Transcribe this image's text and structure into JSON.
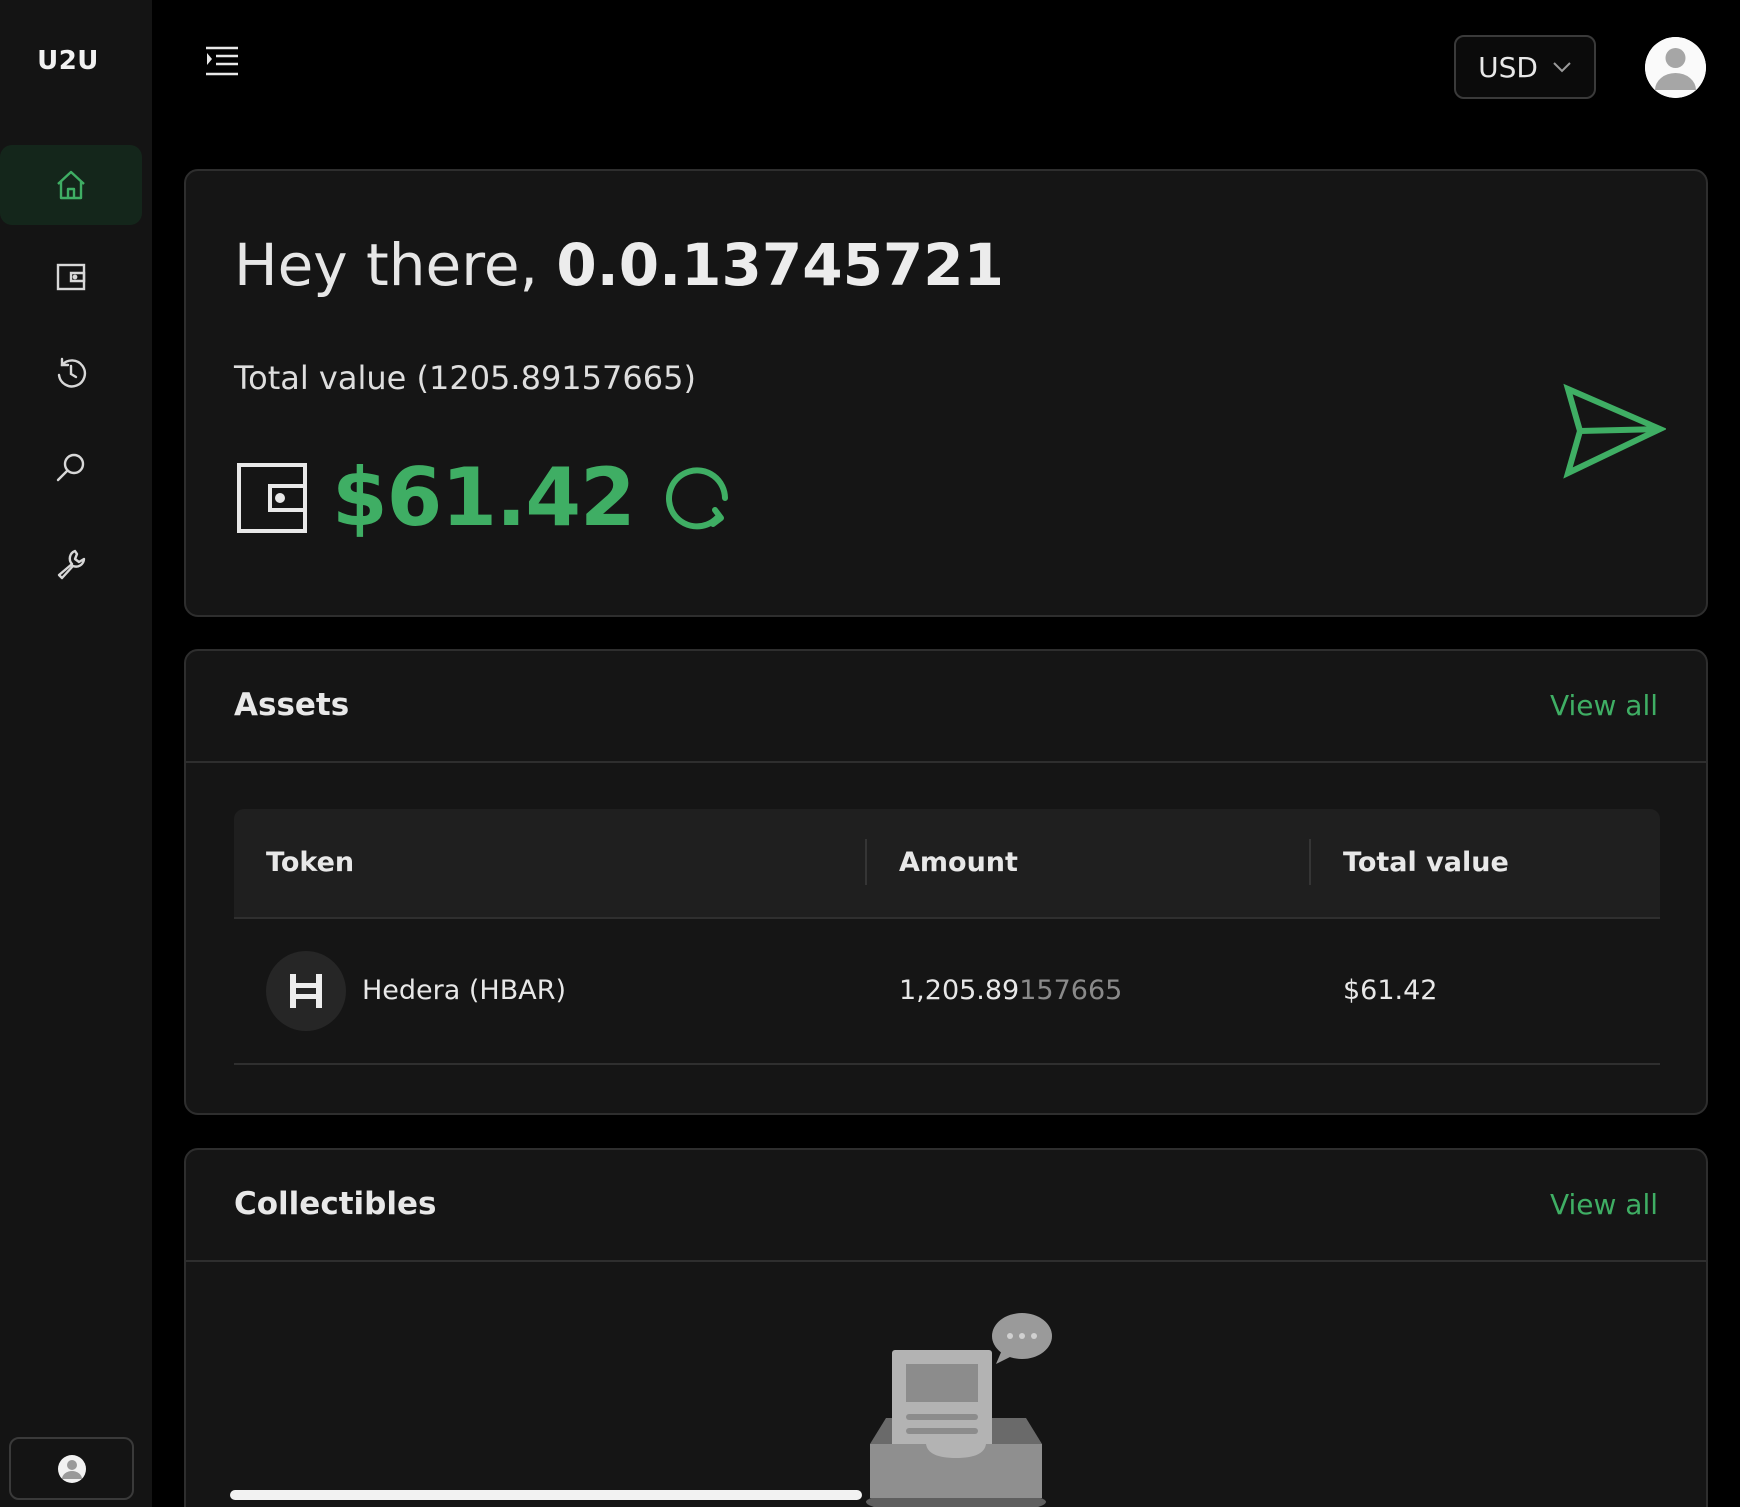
{
  "app": {
    "logo": "U2U"
  },
  "sidebar": {
    "items": [
      {
        "icon": "home-icon",
        "active": true
      },
      {
        "icon": "wallet-icon",
        "active": false
      },
      {
        "icon": "history-icon",
        "active": false
      },
      {
        "icon": "search-icon",
        "active": false
      },
      {
        "icon": "tools-icon",
        "active": false
      }
    ]
  },
  "header": {
    "currency": "USD"
  },
  "hero": {
    "greeting_prefix": "Hey there, ",
    "account_id": "0.0.13745721",
    "total_label": "Total value (1205.89157665)",
    "balance": "$61.42"
  },
  "assets": {
    "title": "Assets",
    "view_all": "View all",
    "columns": [
      "Token",
      "Amount",
      "Total value"
    ],
    "rows": [
      {
        "token": "Hedera  (HBAR)",
        "amount_main": "1,205.89",
        "amount_dim": "157665",
        "value": "$61.42"
      }
    ]
  },
  "collectibles": {
    "title": "Collectibles",
    "view_all": "View all"
  },
  "colors": {
    "accent": "#3fae64",
    "background": "#000000",
    "card": "#151515"
  }
}
